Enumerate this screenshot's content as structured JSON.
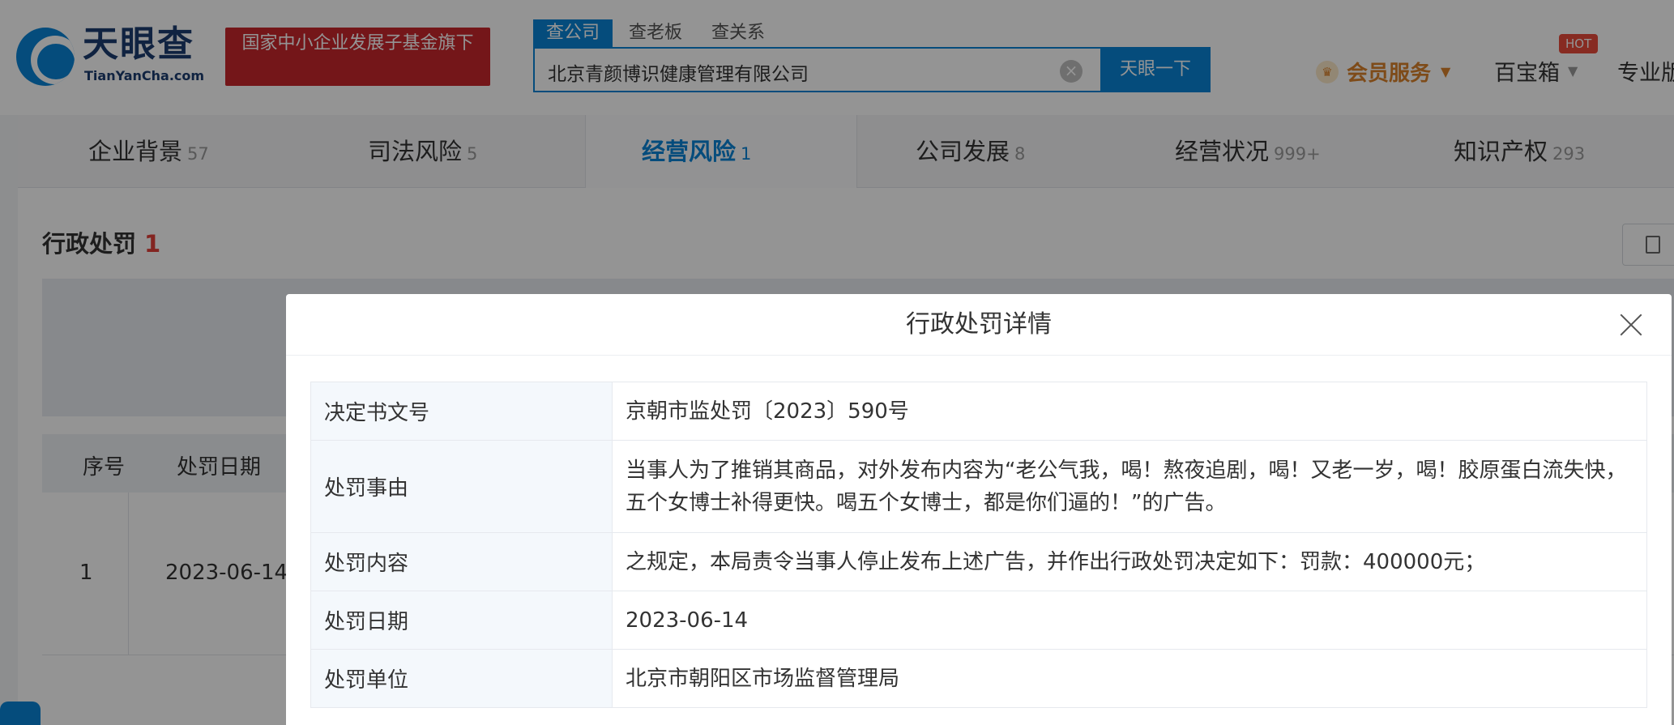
{
  "header": {
    "logo_name": "天眼查",
    "logo_sub": "TianYanCha.com",
    "fund_banner": "国家中小企业发展子基金旗下",
    "search_tabs": [
      "查公司",
      "查老板",
      "查关系"
    ],
    "search_value": "北京青颜博识健康管理有限公司",
    "search_button": "天眼一下",
    "vip_label": "会员服务",
    "baibao_label": "百宝箱",
    "hot_badge": "HOT",
    "pro_label": "专业版"
  },
  "nav_tabs": [
    {
      "label": "企业背景",
      "count": "57"
    },
    {
      "label": "司法风险",
      "count": "5"
    },
    {
      "label": "经营风险",
      "count": "1"
    },
    {
      "label": "公司发展",
      "count": "8"
    },
    {
      "label": "经营状况",
      "count": "999+"
    },
    {
      "label": "知识产权",
      "count": "293"
    }
  ],
  "active_tab": "经营风险",
  "section": {
    "title": "行政处罚",
    "count": "1",
    "table_headers": [
      "序号",
      "处罚日期"
    ],
    "rows": [
      {
        "index": "1",
        "date": "2023-06-14"
      }
    ]
  },
  "modal": {
    "title": "行政处罚详情",
    "fields": [
      {
        "key": "决定书文号",
        "value": "京朝市监处罚〔2023〕590号"
      },
      {
        "key": "处罚事由",
        "value": "当事人为了推销其商品，对外发布内容为“老公气我，喝！熬夜追剧，喝！又老一岁，喝！胶原蛋白流失快，五个女博士补得更快。喝五个女博士，都是你们逼的！”的广告。"
      },
      {
        "key": "处罚内容",
        "value": "之规定，本局责令当事人停止发布上述广告，并作出行政处罚决定如下：罚款：400000元；"
      },
      {
        "key": "处罚日期",
        "value": "2023-06-14"
      },
      {
        "key": "处罚单位",
        "value": "北京市朝阳区市场监督管理局"
      }
    ]
  },
  "colors": {
    "brand_blue": "#0a84d6",
    "fund_red": "#c8262b",
    "vip_orange": "#d9822b",
    "count_red": "#e2403a"
  }
}
